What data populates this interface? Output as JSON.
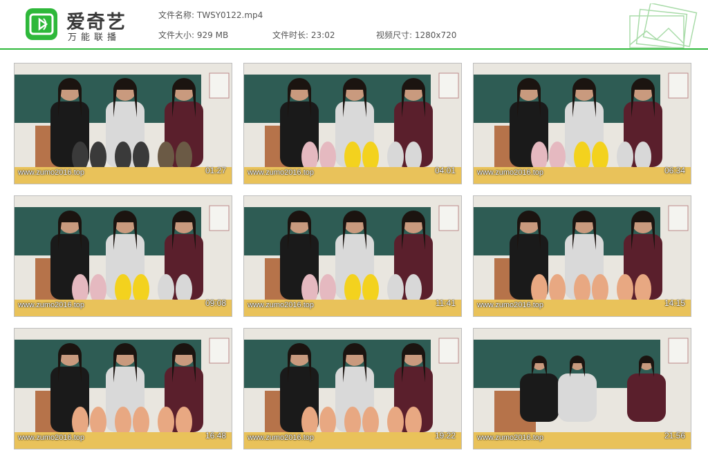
{
  "brand": {
    "name": "爱奇艺",
    "subtitle": "万能联播",
    "accent": "#2eb83a"
  },
  "file_info": {
    "name_label": "文件名称:",
    "name_value": "TWSY0122.mp4",
    "size_label": "文件大小:",
    "size_value": "929 MB",
    "duration_label": "文件时长:",
    "duration_value": "23:02",
    "resolution_label": "视频尺寸:",
    "resolution_value": "1280x720"
  },
  "thumbnails": [
    {
      "timestamp": "01:27",
      "watermark": "www.zumo2016.top"
    },
    {
      "timestamp": "04:01",
      "watermark": "www.zumo2016.top"
    },
    {
      "timestamp": "06:34",
      "watermark": "www.zumo2016.top"
    },
    {
      "timestamp": "09:08",
      "watermark": "www.zumo2016.top"
    },
    {
      "timestamp": "11:41",
      "watermark": "www.zumo2016.top"
    },
    {
      "timestamp": "14:15",
      "watermark": "www.zumo2016.top"
    },
    {
      "timestamp": "16:48",
      "watermark": "www.zumo2016.top"
    },
    {
      "timestamp": "19:22",
      "watermark": "www.zumo2016.top"
    },
    {
      "timestamp": "21:56",
      "watermark": "www.zumo2016.top"
    }
  ]
}
